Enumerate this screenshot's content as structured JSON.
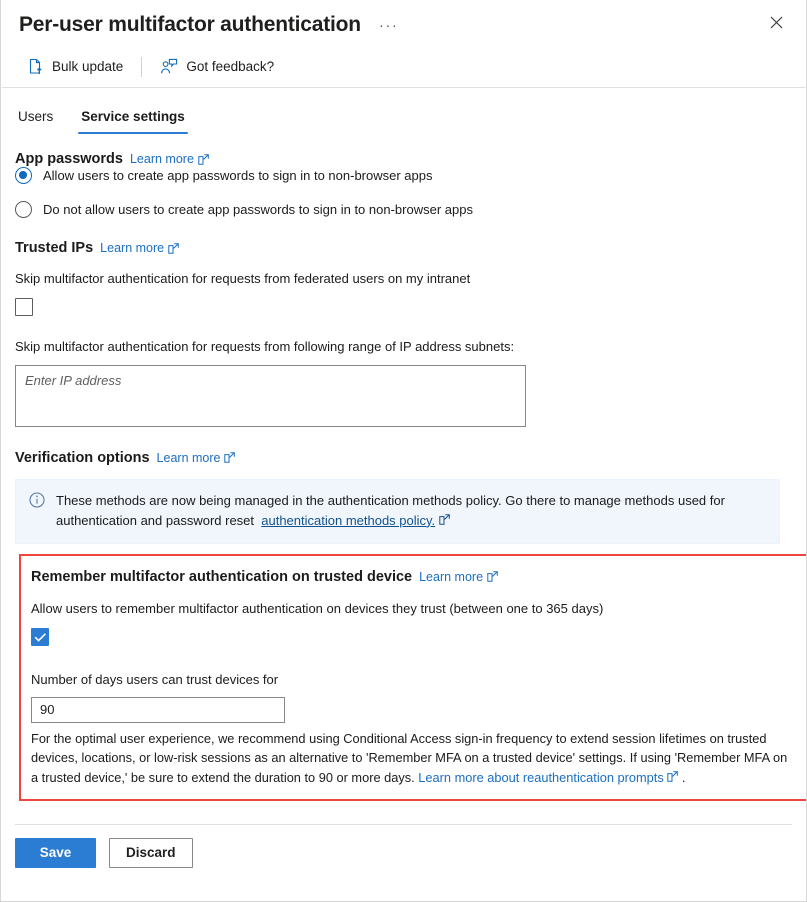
{
  "header": {
    "title": "Per-user multifactor authentication",
    "more_label": "···",
    "close_icon": "close-icon"
  },
  "commandbar": {
    "items": [
      {
        "label": "Bulk update",
        "icon": "bulk-update-icon"
      },
      {
        "label": "Got feedback?",
        "icon": "feedback-person-icon"
      }
    ]
  },
  "tabs": [
    {
      "label": "Users",
      "active": false
    },
    {
      "label": "Service settings",
      "active": true
    }
  ],
  "common": {
    "learn_more": "Learn more",
    "external_link_icon": "external-link-icon"
  },
  "app_passwords": {
    "heading": "App passwords",
    "learn_more": "Learn more",
    "options": [
      {
        "label": "Allow users to create app passwords to sign in to non-browser apps",
        "selected": true
      },
      {
        "label": "Do not allow users to create app passwords to sign in to non-browser apps",
        "selected": false
      }
    ]
  },
  "trusted_ips": {
    "heading": "Trusted IPs",
    "learn_more": "Learn more",
    "federated_label": "Skip multifactor authentication for requests from federated users on my intranet",
    "federated_checked": false,
    "subnets_label": "Skip multifactor authentication for requests from following range of IP address subnets:",
    "subnets_value": "",
    "subnets_placeholder": "Enter IP address"
  },
  "verification_options": {
    "heading": "Verification options",
    "learn_more": "Learn more",
    "banner": {
      "icon": "info-circle-icon",
      "text_before": "These methods are now being managed in the authentication methods policy. Go there to manage methods used for authentication and password reset",
      "link_text": "authentication methods policy.",
      "link_icon": "external-link-icon"
    }
  },
  "remember_mfa": {
    "heading": "Remember multifactor authentication on trusted device",
    "learn_more": "Learn more",
    "allow_label": "Allow users to remember multifactor authentication on devices they trust (between one to 365 days)",
    "allow_checked": true,
    "days_label": "Number of days users can trust devices for",
    "days_value": "90",
    "note_before": "For the optimal user experience, we recommend using Conditional Access sign-in frequency to extend session lifetimes on trusted devices, locations, or low-risk sessions as an alternative to 'Remember MFA on a trusted device' settings. If using 'Remember MFA on a trusted device,' be sure to extend the duration to 90 or more days.",
    "note_link": "Learn more about reauthentication prompts",
    "note_after": ".",
    "highlight_color": "#f0443e"
  },
  "footer": {
    "save_label": "Save",
    "discard_label": "Discard"
  },
  "colors": {
    "accent": "#2b7cd3",
    "link": "#1b6ec2",
    "banner_bg": "#f0f6fc",
    "highlight": "#f0443e"
  }
}
